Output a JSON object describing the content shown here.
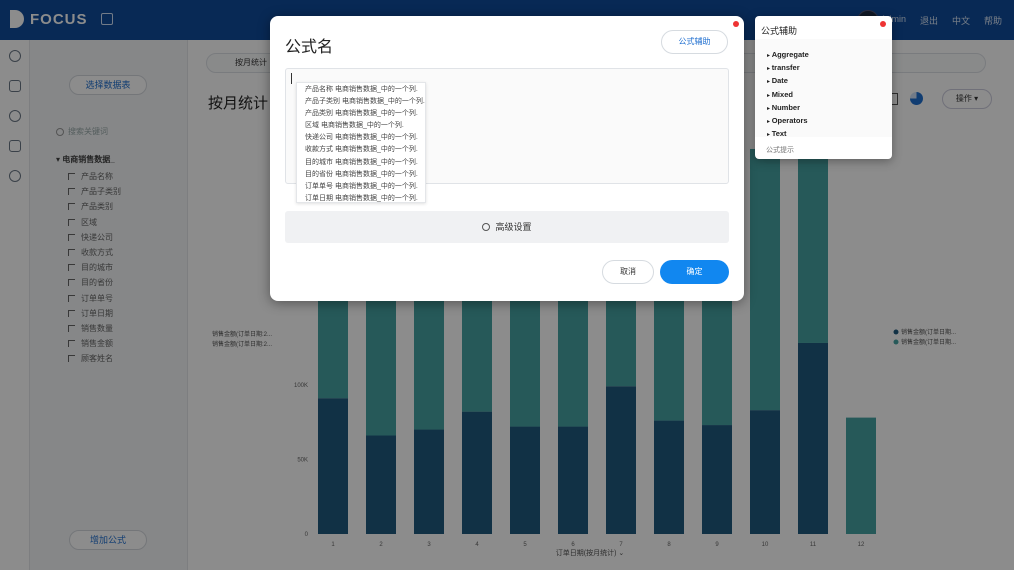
{
  "app": {
    "logo_text": "FOCUS",
    "user": "Admin",
    "logout": "退出",
    "language": "中文",
    "help": "帮助"
  },
  "panel": {
    "select_source": "选择数据表",
    "search_placeholder": "搜索关键词",
    "table_name": "电商销售数据_",
    "add_formula": "增加公式",
    "columns": [
      "产品名称",
      "产品子类别",
      "产品类别",
      "区域",
      "快递公司",
      "收款方式",
      "目的城市",
      "目的省份",
      "订单单号",
      "订单日期",
      "销售数量",
      "销售金额",
      "顾客姓名"
    ]
  },
  "main": {
    "search_value": "按月统计",
    "title": "按月统计",
    "operation_button": "操作"
  },
  "chart_data": {
    "type": "bar",
    "stacked": true,
    "categories": [
      "1",
      "2",
      "3",
      "4",
      "5",
      "6",
      "7",
      "8",
      "9",
      "10",
      "11",
      "12"
    ],
    "series": [
      {
        "name": "销售金额(订单日期...",
        "color": "#1f5a7f",
        "values": [
          91000,
          66000,
          70000,
          82000,
          72000,
          72000,
          99000,
          76000,
          73000,
          83000,
          128000,
          0
        ]
      },
      {
        "name": "销售金额(订单日期...",
        "color": "#46a2a2",
        "values": [
          130000,
          145000,
          140000,
          140000,
          146000,
          146000,
          132000,
          142000,
          144000,
          175000,
          211000,
          78000
        ]
      }
    ],
    "ylim": [
      0,
      260000
    ],
    "yticks": [
      "0",
      "50K",
      "100K"
    ],
    "xlabel": "订单日期(按月统计)",
    "left_labels": [
      "销售金额(订单日期:2...",
      "销售金额(订单日期:2..."
    ],
    "legend": [
      "销售金额(订单日期...",
      "销售金额(订单日期..."
    ],
    "legend_position": "right"
  },
  "modal": {
    "title": "公式名",
    "assist_button": "公式辅助",
    "advanced": "高级设置",
    "cancel": "取消",
    "confirm": "确定",
    "suggestions": [
      "产品名称 电商销售数据_中的一个列.",
      "产品子类别 电商销售数据_中的一个列.",
      "产品类别 电商销售数据_中的一个列.",
      "区域 电商销售数据_中的一个列.",
      "快递公司 电商销售数据_中的一个列.",
      "收款方式 电商销售数据_中的一个列.",
      "目的城市 电商销售数据_中的一个列.",
      "目的省份 电商销售数据_中的一个列.",
      "订单单号 电商销售数据_中的一个列.",
      "订单日期 电商销售数据_中的一个列."
    ]
  },
  "assist_panel": {
    "title": "公式辅助",
    "items": [
      "Aggregate",
      "transfer",
      "Date",
      "Mixed",
      "Number",
      "Operators",
      "Text"
    ],
    "hint": "公式提示"
  }
}
